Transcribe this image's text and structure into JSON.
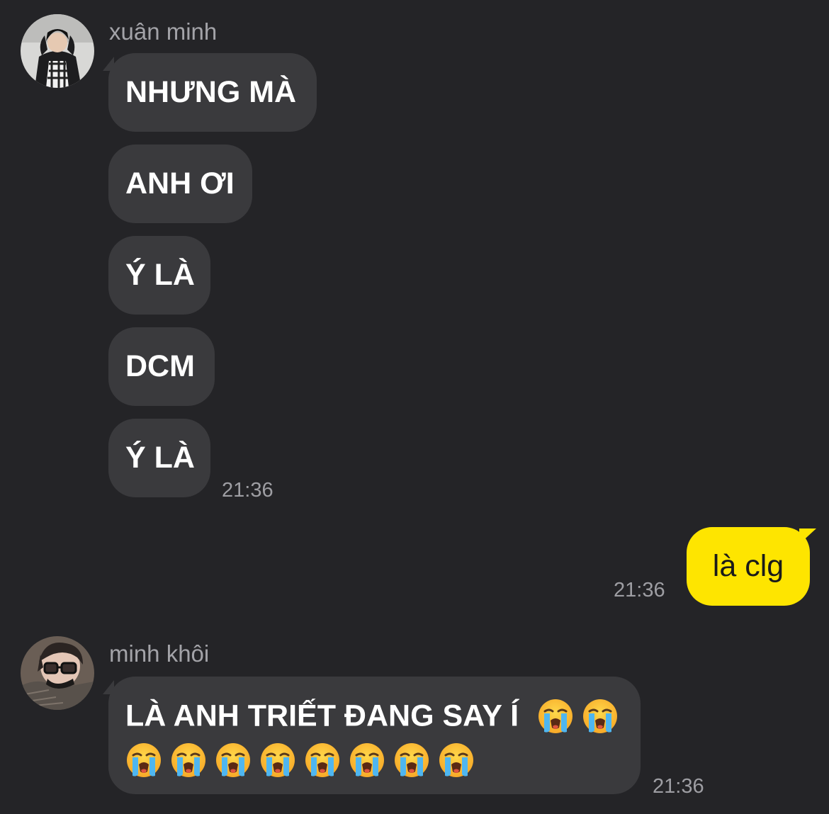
{
  "messages": [
    {
      "sender": "xuân minh",
      "bubbles": [
        "NHƯNG MÀ",
        "ANH ƠI",
        "Ý LÀ",
        "DCM",
        "Ý LÀ"
      ],
      "time": "21:36"
    },
    {
      "mine": true,
      "text": "là clg",
      "time": "21:36"
    },
    {
      "sender": "minh khôi",
      "text_line1": "LÀ ANH TRIẾT ĐANG SAY Í",
      "emoji_line1_count": 2,
      "emoji_line2_count": 8,
      "emoji_name": "loudly-crying-face-emoji",
      "time": "21:36"
    }
  ],
  "colors": {
    "background": "#242427",
    "incoming_bubble": "#3a3a3d",
    "outgoing_bubble": "#fee500",
    "meta_text": "#9e9ea3"
  }
}
